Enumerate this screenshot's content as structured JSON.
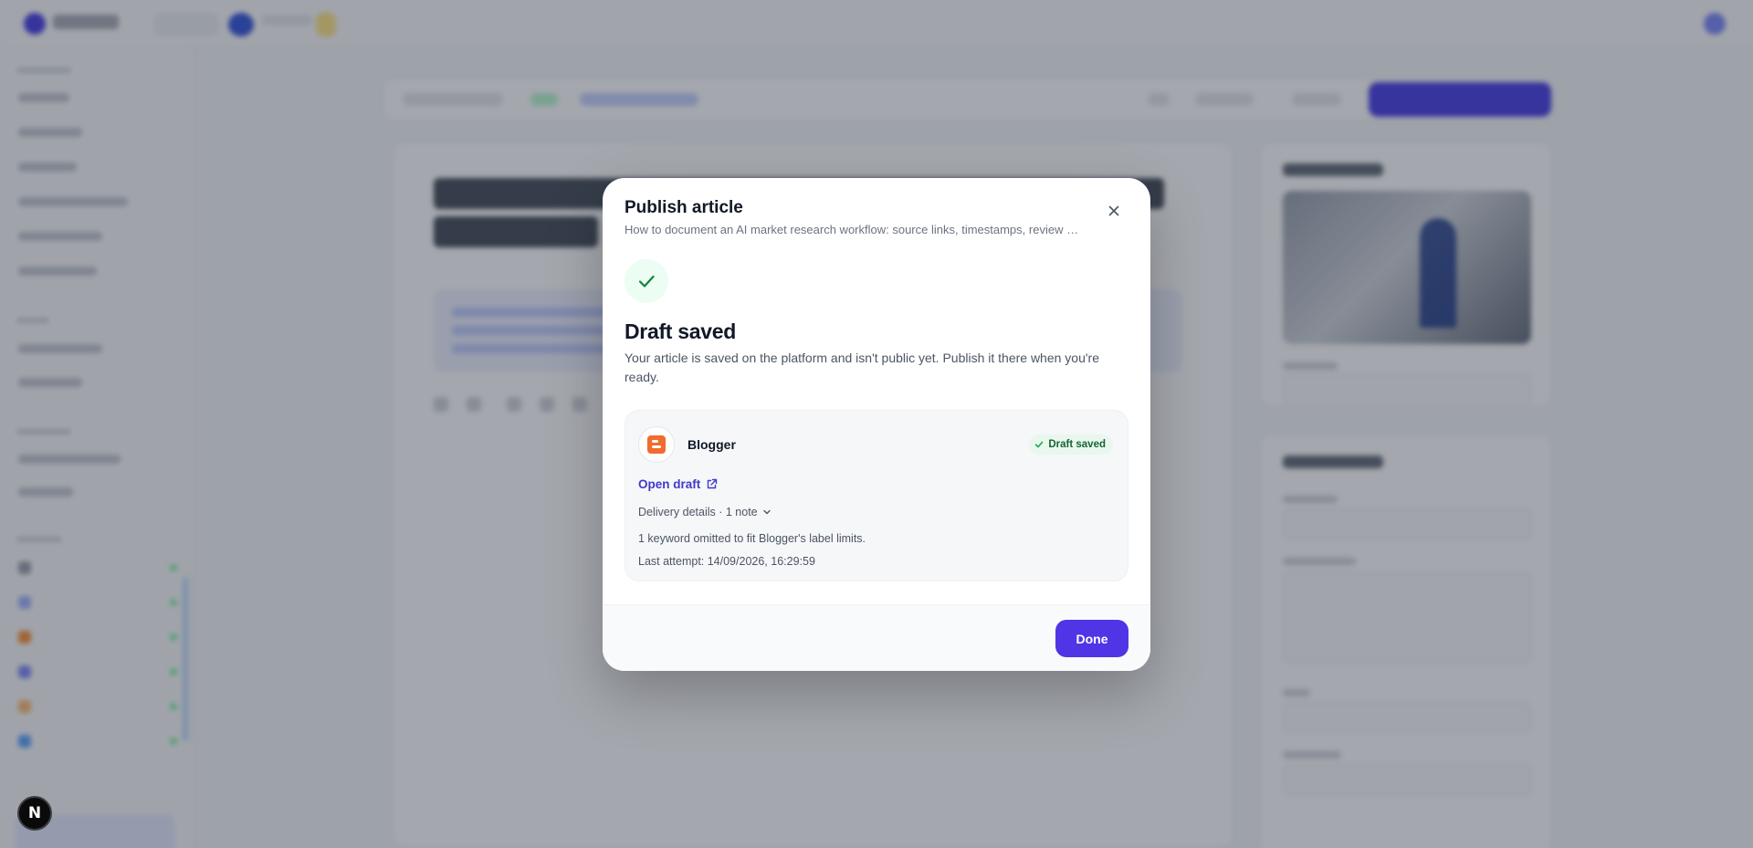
{
  "modal": {
    "title": "Publish article",
    "subtitle": "How to document an AI market research workflow: source links, timestamps, review ch...",
    "status_heading": "Draft saved",
    "status_body": "Your article is saved on the platform and isn't public yet. Publish it there when you're ready.",
    "destination": {
      "platform": "Blogger",
      "badge": "Draft saved",
      "open_link": "Open draft",
      "details_toggle": "Delivery details · 1 note",
      "note": "1 keyword omitted to fit Blogger's label limits.",
      "last_attempt": "Last attempt: 14/09/2026, 16:29:59"
    },
    "done_label": "Done"
  },
  "fab": {
    "label": "N"
  },
  "icons": [
    "close-icon",
    "checkmark-icon",
    "blogger-logo-icon",
    "external-link-icon",
    "chevron-down-icon"
  ],
  "colors": {
    "accent": "#4f35e6",
    "link": "#4338ca",
    "success": "#166534",
    "success_bg": "#e9f7ee",
    "blogger": "#f26b2f"
  }
}
